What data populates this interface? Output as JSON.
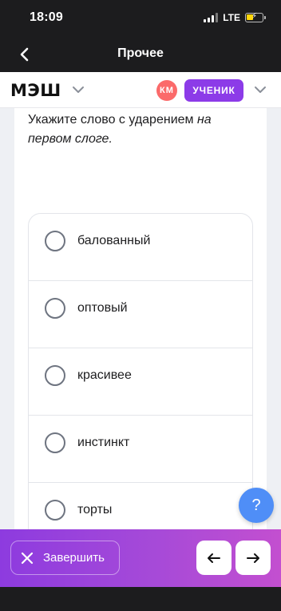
{
  "status_bar": {
    "time": "18:09",
    "network": "LTE"
  },
  "nav": {
    "title": "Прочее"
  },
  "header": {
    "logo": "МЭШ",
    "avatar_initials": "КМ",
    "role": "УЧЕНИК"
  },
  "question": {
    "text_plain": "Укажите слово с ударением ",
    "text_italic": "на первом слоге."
  },
  "options": [
    {
      "label": "балованный"
    },
    {
      "label": "оптовый"
    },
    {
      "label": "красивее"
    },
    {
      "label": "инстинкт"
    },
    {
      "label": "торты"
    }
  ],
  "help": {
    "label": "?"
  },
  "footer": {
    "finish_label": "Завершить"
  },
  "colors": {
    "accent": "#8c3be8",
    "avatar": "#fb6a6a",
    "help": "#4f8ef7"
  }
}
